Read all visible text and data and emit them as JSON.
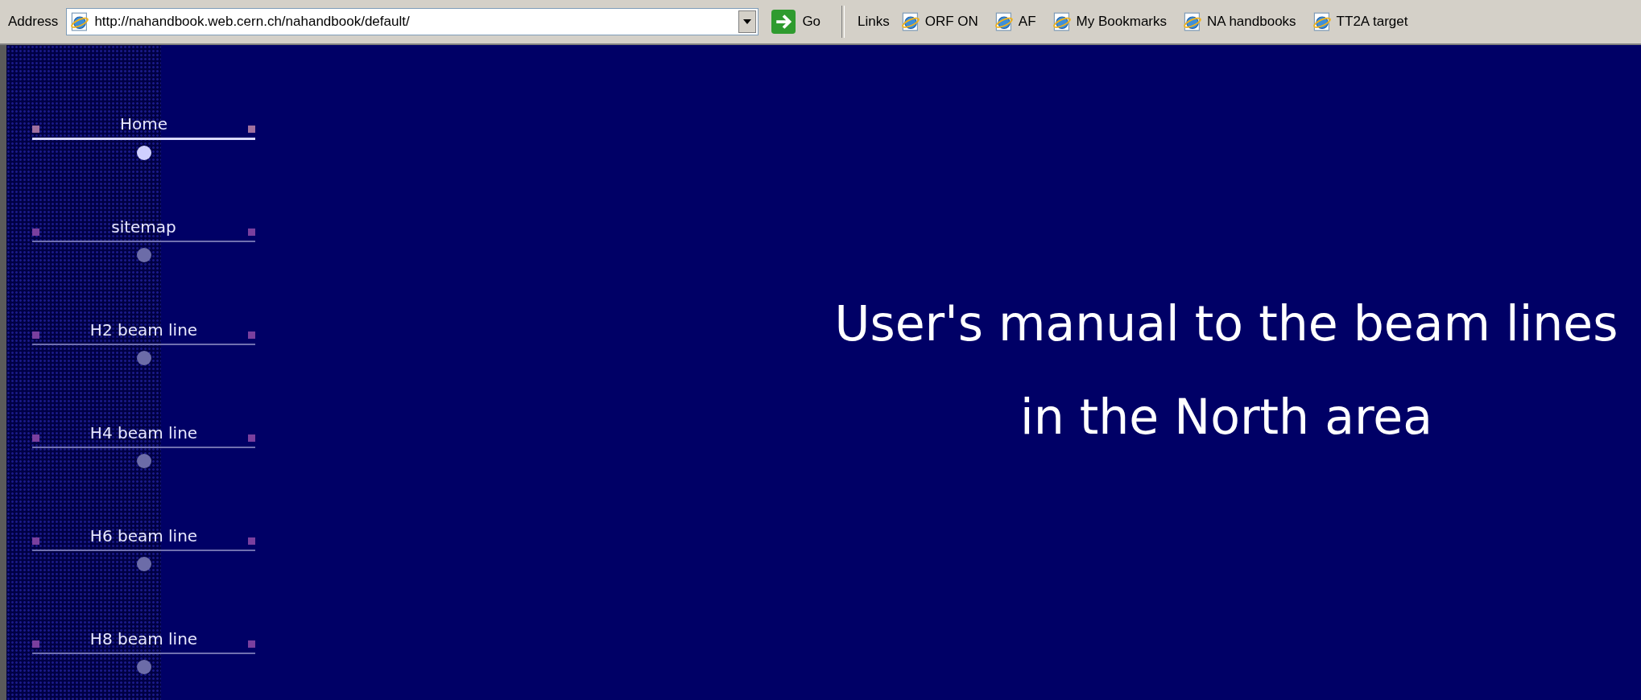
{
  "toolbar": {
    "address_label": "Address",
    "address": "http://nahandbook.web.cern.ch/nahandbook/default/",
    "go": "Go",
    "links_label": "Links",
    "links": [
      {
        "label": "ORF ON"
      },
      {
        "label": "AF"
      },
      {
        "label": "My Bookmarks"
      },
      {
        "label": "NA handbooks"
      },
      {
        "label": "TT2A target"
      }
    ]
  },
  "sidebar": {
    "items": [
      {
        "label": "Home",
        "selected": true
      },
      {
        "label": "sitemap",
        "selected": false
      },
      {
        "label": "H2 beam line",
        "selected": false
      },
      {
        "label": "H4 beam line",
        "selected": false
      },
      {
        "label": "H6 beam line",
        "selected": false
      },
      {
        "label": "H8 beam line",
        "selected": false
      }
    ]
  },
  "heading": [
    "User's manual to the beam lines",
    "in the North area"
  ]
}
